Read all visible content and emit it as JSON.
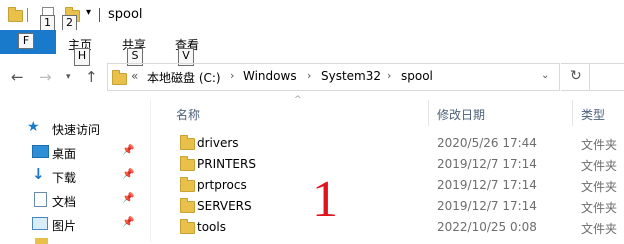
{
  "titlebar": {
    "title": "spool",
    "keytips": [
      "1",
      "2"
    ],
    "file_keytip": "F"
  },
  "ribbon": {
    "tabs": [
      {
        "label": "主页",
        "keytip": "H"
      },
      {
        "label": "共享",
        "keytip": "S"
      },
      {
        "label": "查看",
        "keytip": "V"
      }
    ]
  },
  "address": {
    "overflow": "«",
    "crumbs": [
      "本地磁盘 (C:)",
      "Windows",
      "System32",
      "spool"
    ]
  },
  "sidebar": {
    "items": [
      {
        "label": "快速访问",
        "icon": "star-icon",
        "pinned": false
      },
      {
        "label": "桌面",
        "icon": "desktop-icon",
        "pinned": true
      },
      {
        "label": "下载",
        "icon": "download-icon",
        "pinned": true
      },
      {
        "label": "文档",
        "icon": "document-icon",
        "pinned": true
      },
      {
        "label": "图片",
        "icon": "picture-icon",
        "pinned": true
      }
    ]
  },
  "columns": {
    "name": "名称",
    "date": "修改日期",
    "type": "类型"
  },
  "files": [
    {
      "name": "drivers",
      "date": "2020/5/26 17:44",
      "type": "文件夹"
    },
    {
      "name": "PRINTERS",
      "date": "2019/12/7 17:14",
      "type": "文件夹"
    },
    {
      "name": "prtprocs",
      "date": "2019/12/7 17:14",
      "type": "文件夹"
    },
    {
      "name": "SERVERS",
      "date": "2019/12/7 17:14",
      "type": "文件夹"
    },
    {
      "name": "tools",
      "date": "2022/10/25 0:08",
      "type": "文件夹"
    }
  ],
  "annotation": "1",
  "colors": {
    "accent": "#1979ca",
    "folder": "#e8c04a",
    "annotation": "#e0141e"
  }
}
